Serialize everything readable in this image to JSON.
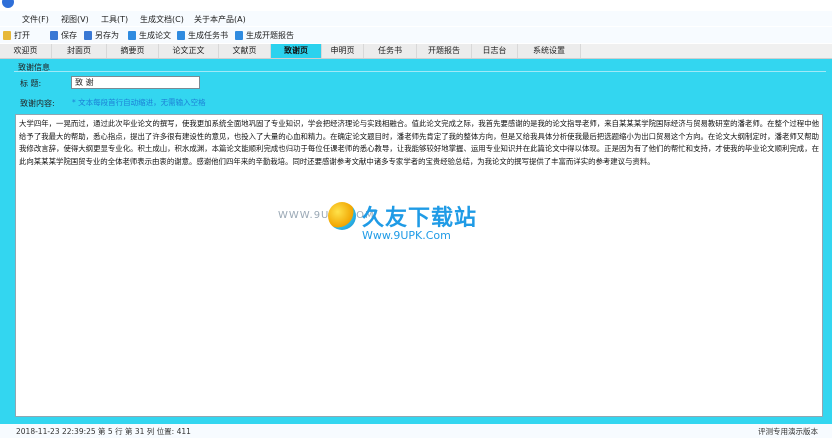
{
  "menu": {
    "items": [
      "文件(F)",
      "视图(V)",
      "工具(T)",
      "生成文档(C)",
      "关于本产品(A)"
    ]
  },
  "toolbar": {
    "open": "打开",
    "save": "保存",
    "save_as": "另存为",
    "gen_paper": "生成论文",
    "gen_task": "生成任务书",
    "gen_proposal": "生成开题报告"
  },
  "tabs": [
    "欢迎页",
    "封面页",
    "摘要页",
    "论文正文",
    "文献页",
    "致谢页",
    "申明页",
    "任务书",
    "开题报告",
    "日志台",
    "系统设置"
  ],
  "active_tab": "致谢页",
  "panel": {
    "group_title": "致谢信息",
    "title_label": "标    题:",
    "title_value": "致    谢",
    "content_label": "致谢内容:",
    "hint": "* 文本每段首行自动缩进，无需输入空格"
  },
  "editor": {
    "text": "大学四年，一晃而过，通过此次毕业论文的撰写，使我更加系统全面地巩固了专业知识，学会把经济理论与实践相融合。值此论文完成之际，我首先要感谢的是我的论文指导老师，来自某某某学院国际经济与贸易教研室的潘老师。在整个过程中他给予了我最大的帮助，悉心指点，提出了许多很有建设性的意见，也投入了大量的心血和精力。在确定论文题目时，潘老师先肯定了我的整体方向，但是又给我具体分析使我最后把选题缩小为出口贸易这个方向。在论文大纲制定时，潘老师又帮助我修改言辞，使得大纲更显专业化。积土成山，积水成渊，本篇论文能顺利完成也归功于每位任课老师的悉心教导，让我能够较好地掌握、运用专业知识并在此篇论文中得以体现。正是因为有了他们的帮忙和支持，才使我的毕业论文顺利完成，在此向某某某学院国贸专业的全体老师表示由衷的谢意。感谢他们四年来的辛勤栽培。同时还要感谢参考文献中诸多专家学者的宝贵经验总结，为我论文的撰写提供了丰富而详实的参考建议与资料。"
  },
  "watermark": {
    "site": "WWW.9UPK.COM",
    "brand": "久友下载站",
    "url": "Www.9UPK.Com"
  },
  "status": {
    "left": "2018-11-23 22:39:25  第 5 行 第 31 列  位置: 411",
    "right": "评测专用演示版本"
  },
  "colors": {
    "content_bg": "#33d6f0",
    "active_tab": "#2bd2ee",
    "hint": "#1c7fd6"
  }
}
